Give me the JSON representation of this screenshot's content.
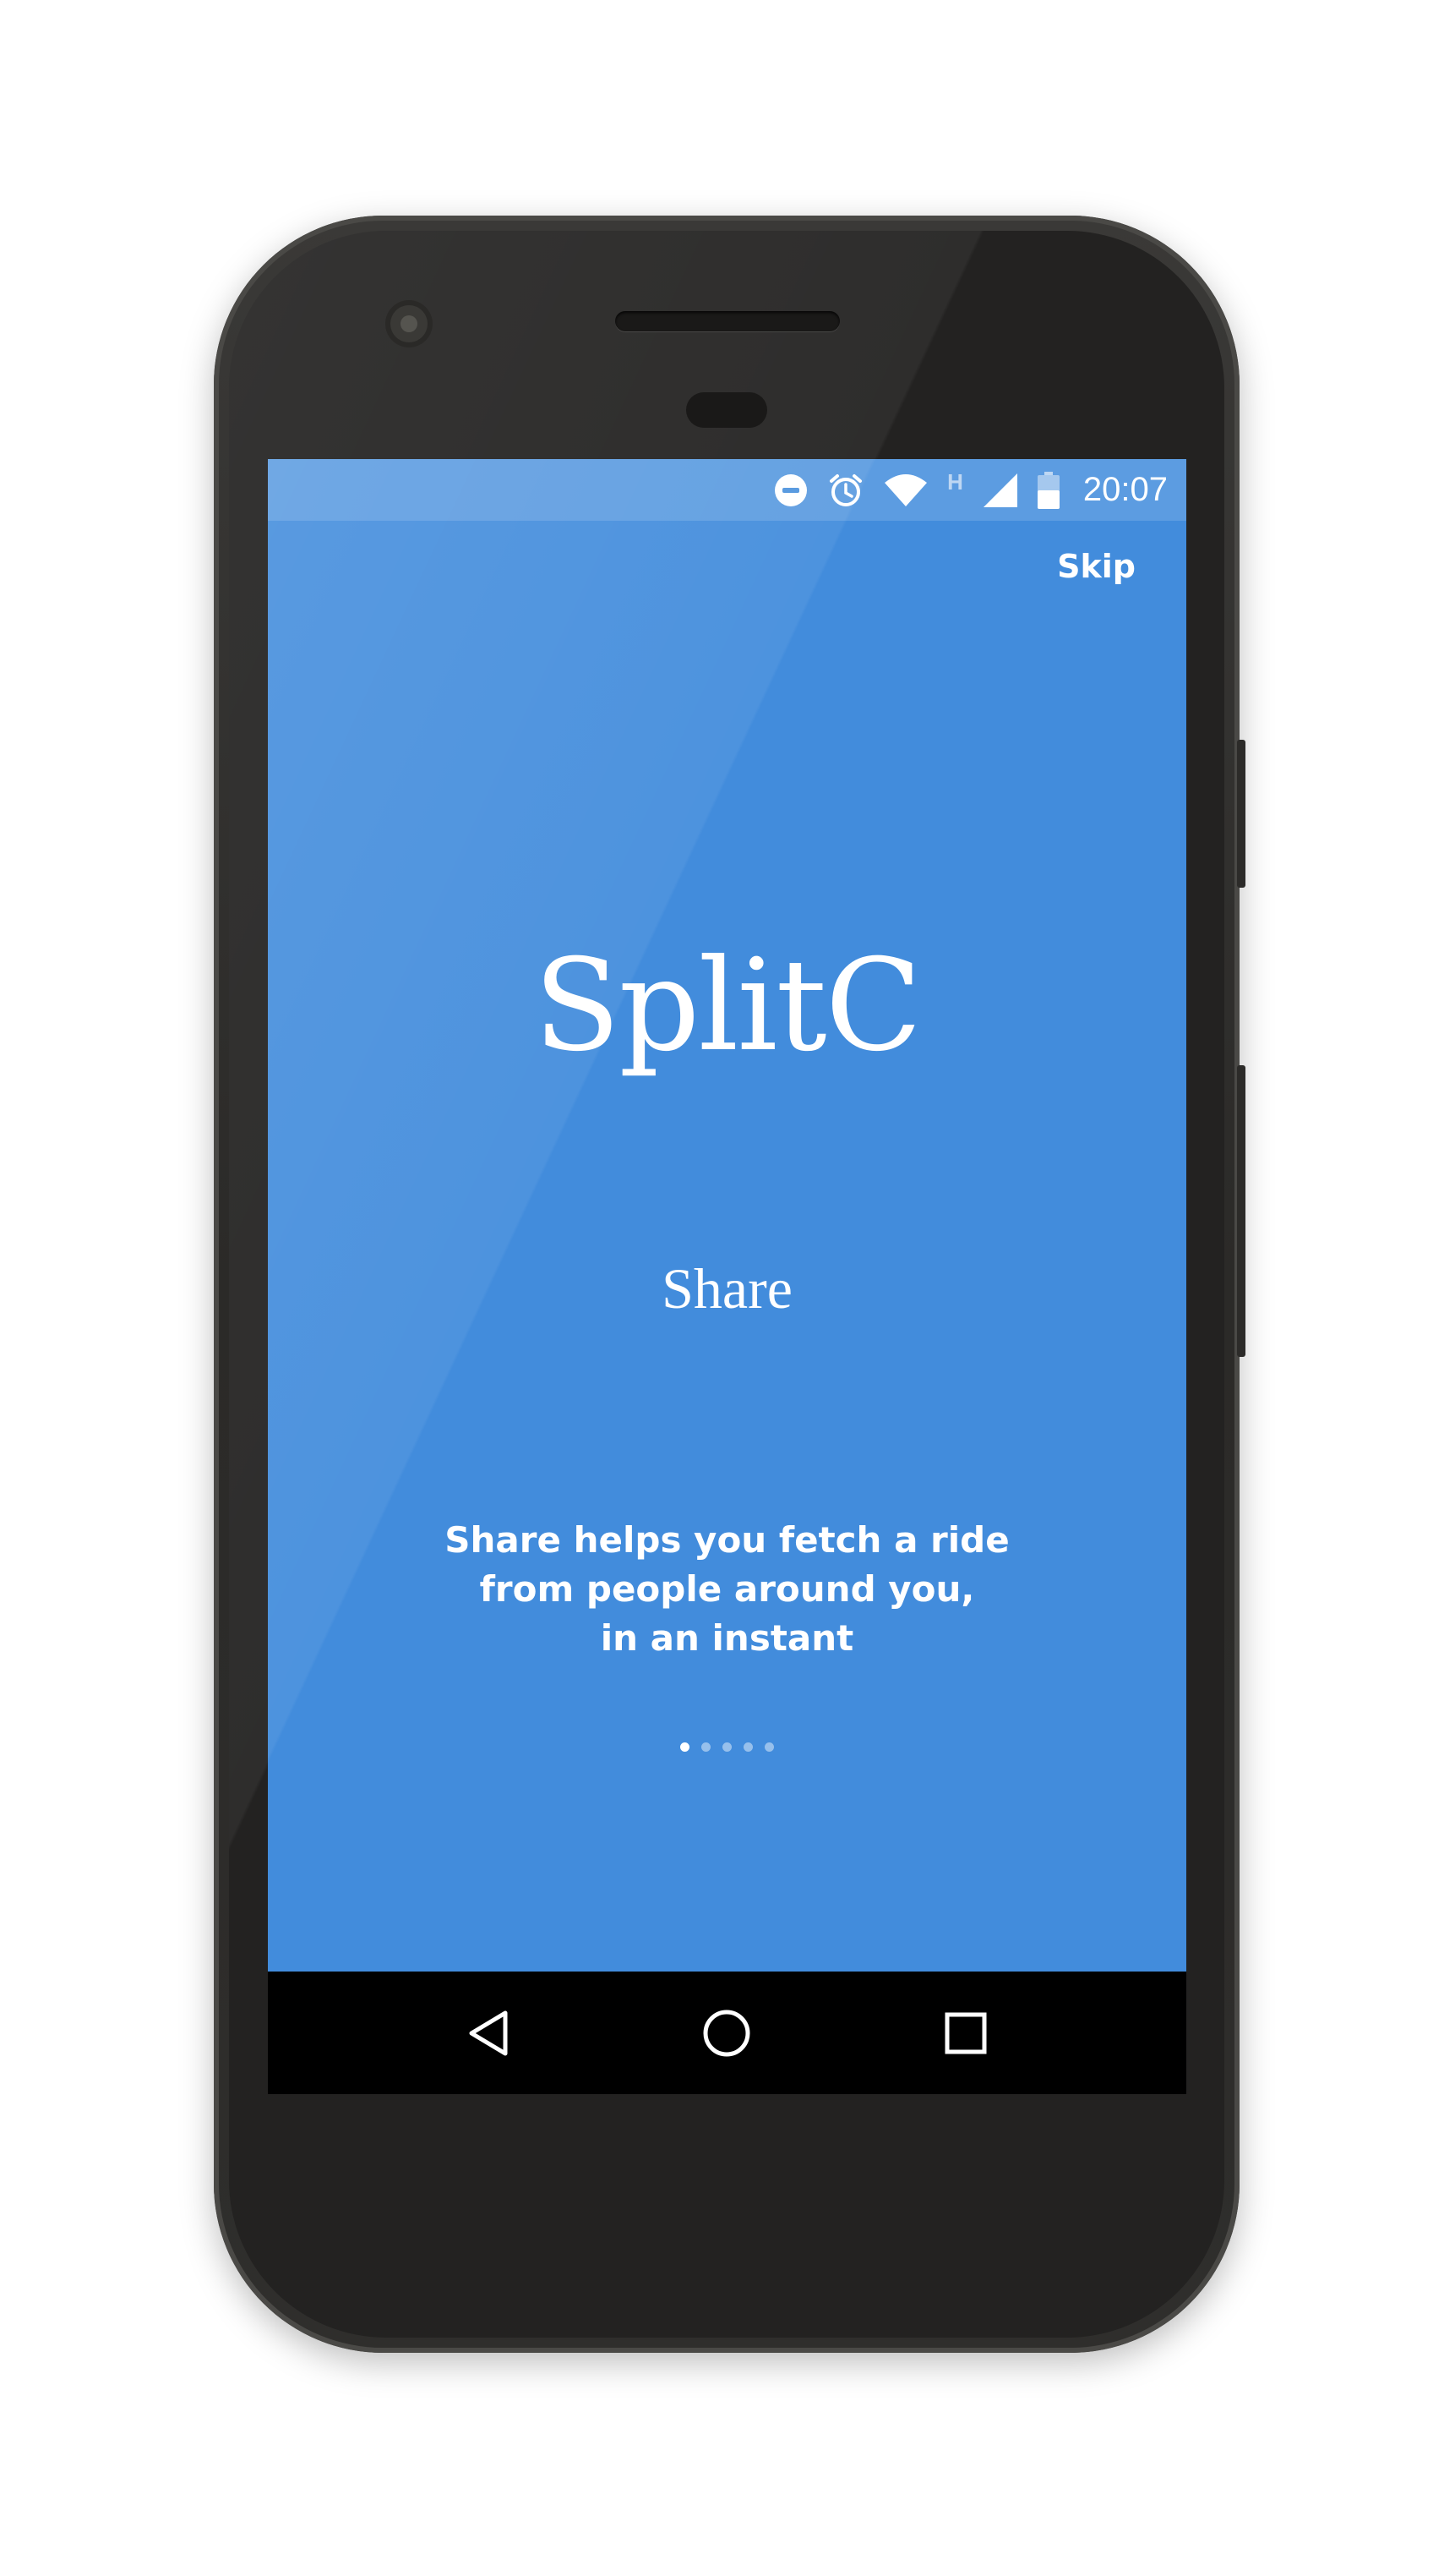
{
  "status_bar": {
    "time": "20:07",
    "network_type": "H",
    "icons": [
      "do-not-disturb-icon",
      "alarm-icon",
      "wifi-icon",
      "cell-signal-icon",
      "battery-icon"
    ]
  },
  "onboarding": {
    "skip_label": "Skip",
    "app_name": "SplitC",
    "slide_title": "Share",
    "description_lines": [
      "Share helps you fetch a ride",
      "from people around you,",
      "in an instant"
    ],
    "page_count": 5,
    "current_page": 1
  },
  "navigation_bar": {
    "buttons": [
      "back-icon",
      "home-icon",
      "recents-icon"
    ]
  },
  "colors": {
    "screen_background": "#428cdc",
    "text": "#ffffff",
    "phone_body": "#2b2a28",
    "nav_bar": "#000000"
  }
}
